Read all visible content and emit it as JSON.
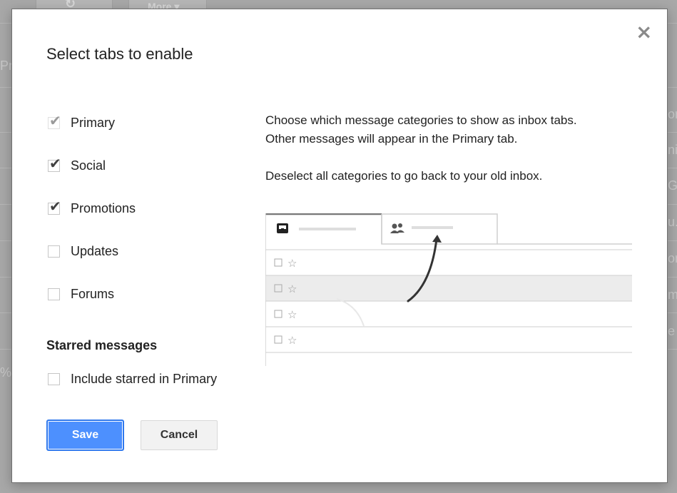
{
  "background": {
    "more_button_label": "More ▾",
    "fragments": [
      "Pr",
      "%",
      "or",
      "nin",
      "Go",
      "u.",
      "or",
      "ma",
      "e"
    ]
  },
  "dialog": {
    "title": "Select tabs to enable",
    "close_icon": "close-icon",
    "tabs": [
      {
        "label": "Primary",
        "checked": true,
        "disabled": true
      },
      {
        "label": "Social",
        "checked": true,
        "disabled": false
      },
      {
        "label": "Promotions",
        "checked": true,
        "disabled": false
      },
      {
        "label": "Updates",
        "checked": false,
        "disabled": false
      },
      {
        "label": "Forums",
        "checked": false,
        "disabled": false
      }
    ],
    "starred_section": {
      "heading": "Starred messages",
      "option_label": "Include starred in Primary",
      "checked": false
    },
    "description": {
      "line1": "Choose which message categories to show as inbox tabs.",
      "line2": "Other messages will appear in the Primary tab.",
      "line3": "Deselect all categories to go back to your old inbox."
    },
    "save_label": "Save",
    "cancel_label": "Cancel"
  },
  "colors": {
    "save_button": "#4d90fe",
    "overlay": "#a8a8a8"
  }
}
